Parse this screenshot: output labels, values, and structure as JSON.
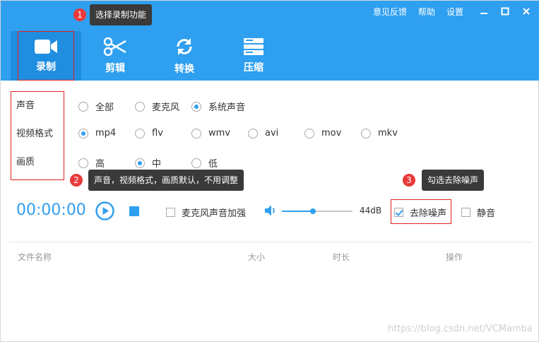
{
  "top_links": [
    "意见反馈",
    "帮助",
    "设置"
  ],
  "toolbar": [
    {
      "label": "录制",
      "icon": "video-camera-icon",
      "active": true
    },
    {
      "label": "剪辑",
      "icon": "scissors-icon",
      "active": false
    },
    {
      "label": "转换",
      "icon": "convert-icon",
      "active": false
    },
    {
      "label": "压缩",
      "icon": "compress-icon",
      "active": false
    }
  ],
  "annotations": {
    "tip1": {
      "badge": "1",
      "text": "选择录制功能"
    },
    "tip2": {
      "badge": "2",
      "text": "声音，视频格式，画质默认，不用调整"
    },
    "tip3": {
      "badge": "3",
      "text": "勾选去除噪声"
    }
  },
  "settings": {
    "sound": {
      "label": "声音",
      "options": [
        "全部",
        "麦克风",
        "系统声音"
      ],
      "selected": "系统声音"
    },
    "format": {
      "label": "视频格式",
      "options": [
        "mp4",
        "flv",
        "wmv",
        "avi",
        "mov",
        "mkv"
      ],
      "selected": "mp4"
    },
    "quality": {
      "label": "画质",
      "options": [
        "高",
        "中",
        "低"
      ],
      "selected": "中"
    }
  },
  "controls": {
    "timer": "00:00:00",
    "mic_boost_label": "麦克风声音加强",
    "mic_boost_checked": false,
    "volume_level": 0.44,
    "volume_text": "44dB",
    "denoise_label": "去除噪声",
    "denoise_checked": true,
    "mute_label": "静音",
    "mute_checked": false
  },
  "file_table": {
    "columns": [
      "文件名称",
      "大小",
      "时长",
      "操作"
    ]
  },
  "watermark": "https://blog.csdn.net/VCMamba",
  "colors": {
    "accent": "#2f9ff0",
    "annotation_red": "#e02020",
    "tooltip_bg": "#3a3a3a"
  }
}
